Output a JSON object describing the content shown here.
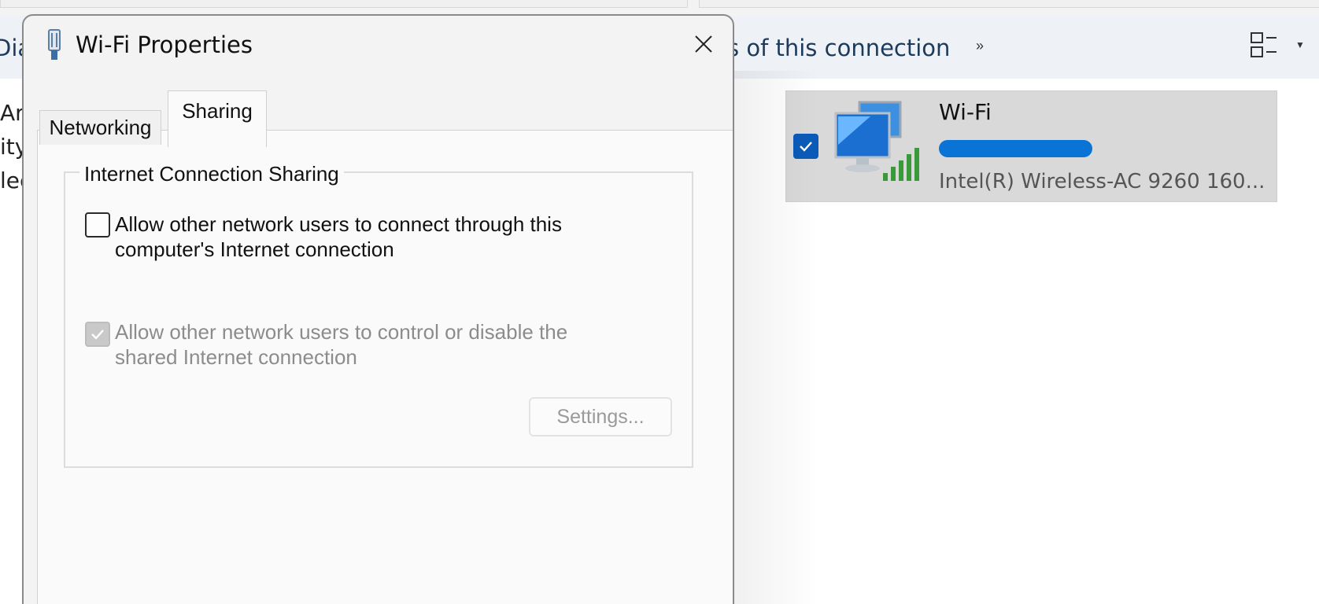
{
  "background_window": {
    "command_bar": {
      "left_fragment": "Diag",
      "connection_action": "s of this connection",
      "more_label": "»"
    },
    "left_fragments": [
      "Ar",
      "ity",
      "lec"
    ],
    "connection": {
      "name": "Wi-Fi",
      "network_hidden": "",
      "adapter": "Intel(R) Wireless-AC 9260 160..."
    }
  },
  "dialog": {
    "title": "Wi-Fi Properties",
    "tabs": [
      {
        "label": "Networking",
        "selected": false
      },
      {
        "label": "Sharing",
        "selected": true
      }
    ],
    "sharing": {
      "group_title": "Internet Connection Sharing",
      "options": [
        {
          "label_line1": "Allow other network users to connect through this",
          "label_line2": "computer's Internet connection",
          "checked": false,
          "enabled": true
        },
        {
          "label_line1": "Allow other network users to control or disable the",
          "label_line2": "shared Internet connection",
          "checked": true,
          "enabled": false
        }
      ],
      "settings_button": "Settings..."
    }
  },
  "colors": {
    "accent": "#0a5bb8",
    "command_text": "#1c3b5c",
    "disabled_text": "#8c8c8c"
  },
  "icons": [
    "wifi-adapter-icon",
    "close-icon",
    "network-computers-icon",
    "signal-bars-icon",
    "checkmark-icon",
    "view-layout-icon",
    "chevron-down-icon"
  ]
}
